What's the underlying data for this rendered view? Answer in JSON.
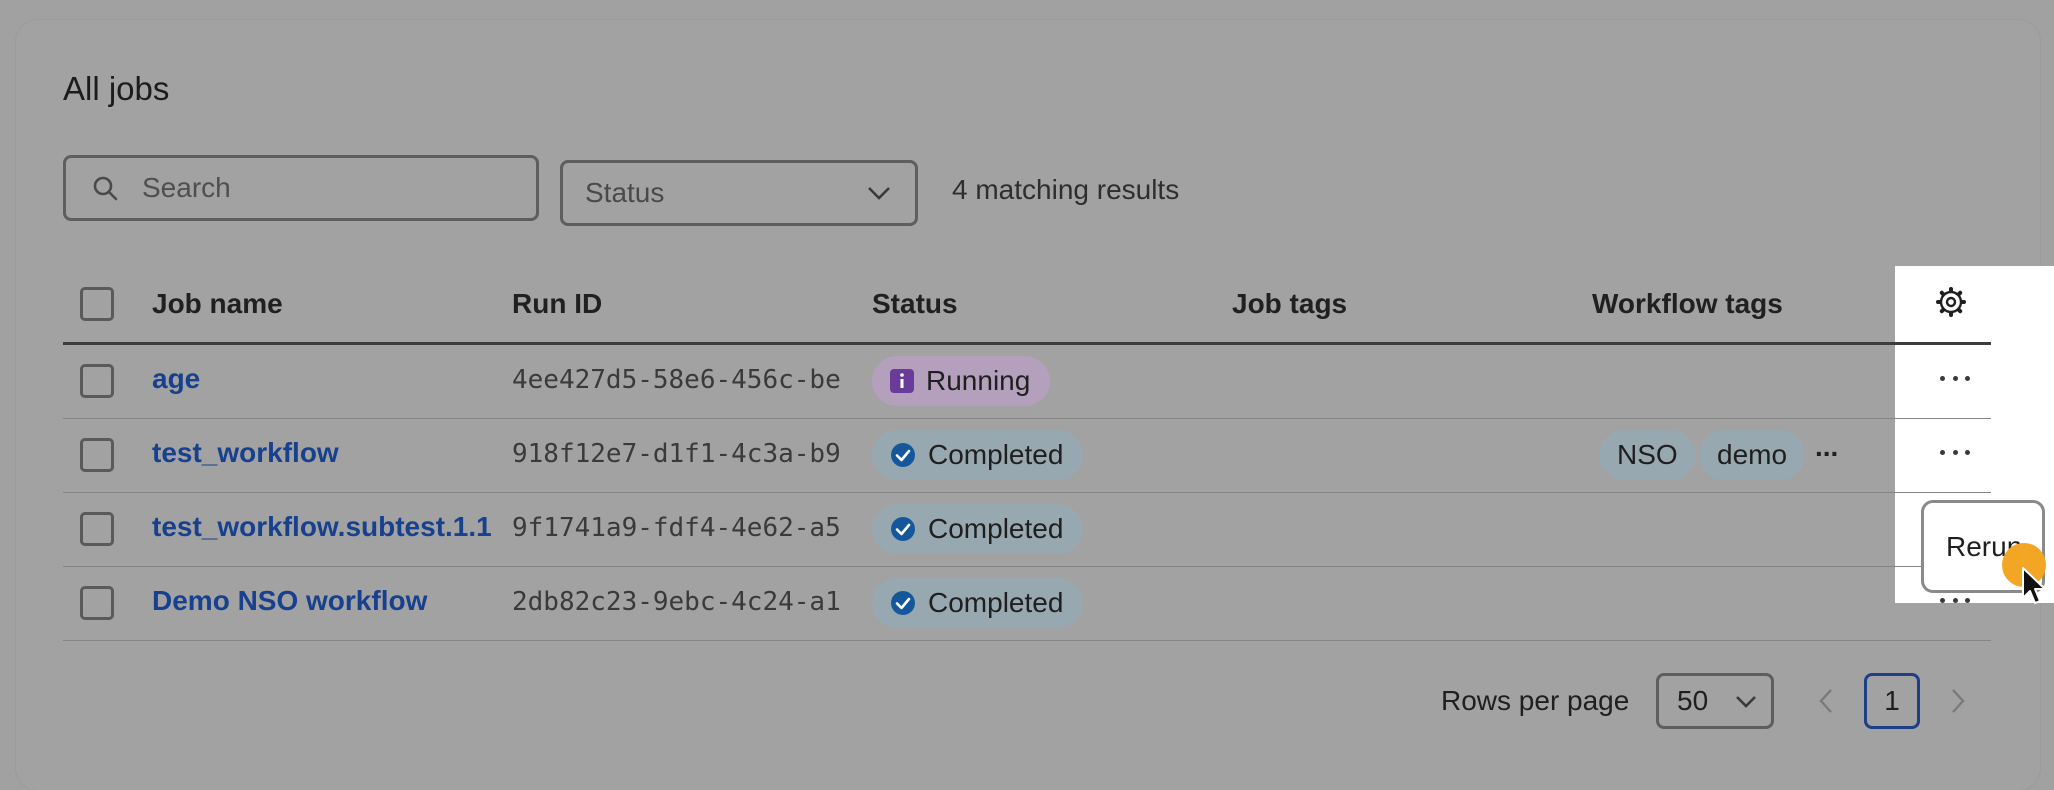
{
  "page": {
    "title": "All jobs"
  },
  "filters": {
    "search_placeholder": "Search",
    "status_label": "Status",
    "results_text": "4 matching results"
  },
  "table": {
    "headers": {
      "job_name": "Job name",
      "run_id": "Run ID",
      "status": "Status",
      "job_tags": "Job tags",
      "workflow_tags": "Workflow tags"
    },
    "rows": [
      {
        "job_name": "age",
        "run_id": "4ee427d5-58e6-456c-be",
        "status": "Running",
        "status_kind": "info",
        "workflow_tags": []
      },
      {
        "job_name": "test_workflow",
        "run_id": "918f12e7-d1f1-4c3a-b9",
        "status": "Completed",
        "status_kind": "success",
        "workflow_tags": [
          "NSO",
          "demo"
        ],
        "more_tags": "..."
      },
      {
        "job_name": "test_workflow.subtest.1.1",
        "run_id": "9f1741a9-fdf4-4e62-a5",
        "status": "Completed",
        "status_kind": "success",
        "workflow_tags": []
      },
      {
        "job_name": "Demo NSO workflow",
        "run_id": "2db82c23-9ebc-4c24-a1",
        "status": "Completed",
        "status_kind": "success",
        "workflow_tags": []
      }
    ]
  },
  "context_menu": {
    "rerun_label": "Rerun"
  },
  "pagination": {
    "rows_per_page_label": "Rows per page",
    "rows_per_page_value": "50",
    "current_page": "1"
  },
  "colors": {
    "link": "#17408f",
    "running_pill": "#b49fbd",
    "completed_pill": "#98a8b0",
    "cursor_highlight": "#f2a623"
  },
  "icons": [
    "search-icon",
    "chevron-down-icon",
    "gear-icon",
    "more-icon",
    "info-icon",
    "check-circle-icon",
    "chevron-left-icon",
    "chevron-right-icon",
    "cursor-icon"
  ]
}
